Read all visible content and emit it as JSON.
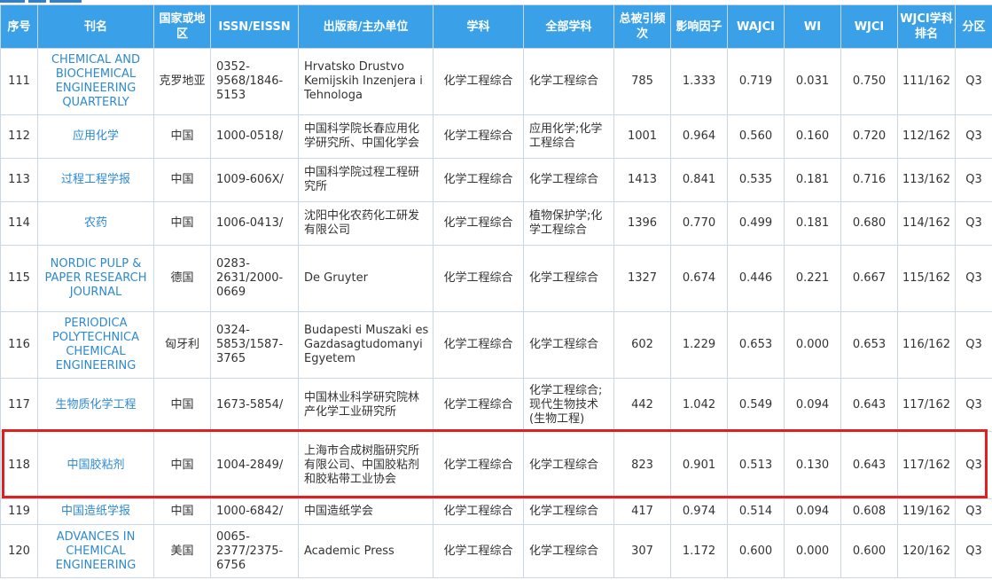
{
  "headers": [
    "序号",
    "刊名",
    "国家或地区",
    "ISSN/EISSN",
    "出版商/主办单位",
    "学科",
    "全部学科",
    "总被引频次",
    "影响因子",
    "WAJCI",
    "WI",
    "WJCI",
    "WJCI学科排名",
    "分区"
  ],
  "rows": [
    {
      "no": "111",
      "title": "CHEMICAL AND BIOCHEMICAL ENGINEERING QUARTERLY",
      "country": "克罗地亚",
      "issn": "0352-9568/1846-5153",
      "publisher": "Hrvatsko Drustvo Kemijskih Inzenjera i Tehnologa",
      "subject": "化学工程综合",
      "all_subjects": "化学工程综合",
      "citations": "785",
      "if": "1.333",
      "wajci": "0.719",
      "wi": "0.031",
      "wjci": "0.750",
      "rank": "111/162",
      "quartile": "Q3"
    },
    {
      "no": "112",
      "title": "应用化学",
      "country": "中国",
      "issn": "1000-0518/",
      "publisher": "中国科学院长春应用化学研究所、中国化学会",
      "subject": "化学工程综合",
      "all_subjects": "应用化学;化学工程综合",
      "citations": "1001",
      "if": "0.964",
      "wajci": "0.560",
      "wi": "0.160",
      "wjci": "0.720",
      "rank": "112/162",
      "quartile": "Q3"
    },
    {
      "no": "113",
      "title": "过程工程学报",
      "country": "中国",
      "issn": "1009-606X/",
      "publisher": "中国科学院过程工程研究所",
      "subject": "化学工程综合",
      "all_subjects": "化学工程综合",
      "citations": "1413",
      "if": "0.841",
      "wajci": "0.535",
      "wi": "0.181",
      "wjci": "0.716",
      "rank": "113/162",
      "quartile": "Q3"
    },
    {
      "no": "114",
      "title": "农药",
      "country": "中国",
      "issn": "1006-0413/",
      "publisher": "沈阳中化农药化工研发有限公司",
      "subject": "化学工程综合",
      "all_subjects": "植物保护学;化学工程综合",
      "citations": "1396",
      "if": "0.770",
      "wajci": "0.499",
      "wi": "0.181",
      "wjci": "0.680",
      "rank": "114/162",
      "quartile": "Q3"
    },
    {
      "no": "115",
      "title": "NORDIC PULP & PAPER RESEARCH JOURNAL",
      "country": "德国",
      "issn": "0283-2631/2000-0669",
      "publisher": "De Gruyter",
      "subject": "化学工程综合",
      "all_subjects": "化学工程综合",
      "citations": "1327",
      "if": "0.674",
      "wajci": "0.446",
      "wi": "0.221",
      "wjci": "0.667",
      "rank": "115/162",
      "quartile": "Q3"
    },
    {
      "no": "116",
      "title": "PERIODICA POLYTECHNICA CHEMICAL ENGINEERING",
      "country": "匈牙利",
      "issn": "0324-5853/1587-3765",
      "publisher": "Budapesti Muszaki es Gazdasagtudomanyi Egyetem",
      "subject": "化学工程综合",
      "all_subjects": "化学工程综合",
      "citations": "602",
      "if": "1.229",
      "wajci": "0.653",
      "wi": "0.000",
      "wjci": "0.653",
      "rank": "116/162",
      "quartile": "Q3"
    },
    {
      "no": "117",
      "title": "生物质化学工程",
      "country": "中国",
      "issn": "1673-5854/",
      "publisher": "中国林业科学研究院林产化学工业研究所",
      "subject": "化学工程综合",
      "all_subjects": "化学工程综合;现代生物技术(生物工程)",
      "citations": "442",
      "if": "1.042",
      "wajci": "0.549",
      "wi": "0.094",
      "wjci": "0.643",
      "rank": "117/162",
      "quartile": "Q3"
    },
    {
      "no": "118",
      "title": "中国胶粘剂",
      "country": "中国",
      "issn": "1004-2849/",
      "publisher": "上海市合成树脂研究所有限公司、中国胶粘剂和胶粘带工业协会",
      "subject": "化学工程综合",
      "all_subjects": "化学工程综合",
      "citations": "823",
      "if": "0.901",
      "wajci": "0.513",
      "wi": "0.130",
      "wjci": "0.643",
      "rank": "117/162",
      "quartile": "Q3"
    },
    {
      "no": "119",
      "title": "中国造纸学报",
      "country": "中国",
      "issn": "1000-6842/",
      "publisher": "中国造纸学会",
      "subject": "化学工程综合",
      "all_subjects": "化学工程综合",
      "citations": "417",
      "if": "0.974",
      "wajci": "0.514",
      "wi": "0.094",
      "wjci": "0.608",
      "rank": "119/162",
      "quartile": "Q3"
    },
    {
      "no": "120",
      "title": "ADVANCES IN CHEMICAL ENGINEERING",
      "country": "美国",
      "issn": "0065-2377/2375-6756",
      "publisher": "Academic Press",
      "subject": "化学工程综合",
      "all_subjects": "化学工程综合",
      "citations": "307",
      "if": "1.172",
      "wajci": "0.600",
      "wi": "0.000",
      "wjci": "0.600",
      "rank": "120/162",
      "quartile": "Q3"
    }
  ],
  "colors": {
    "header_bg": "#3aa0e8",
    "title_link": "#2d8ad0",
    "highlight_border": "#e02020"
  }
}
